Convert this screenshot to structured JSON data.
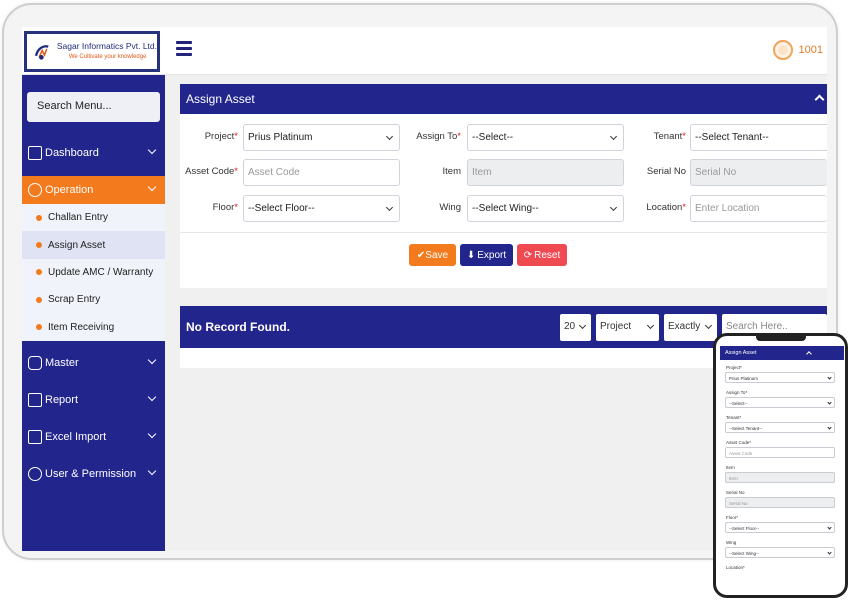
{
  "brand": {
    "name": "Sagar Informatics Pvt. Ltd.",
    "tagline": "We Cultivate your knowledge"
  },
  "header": {
    "user_id": "1001"
  },
  "sidebar": {
    "search_label": "Search Menu...",
    "items": [
      {
        "label": "Dashboard",
        "icon": "dashboard-icon"
      },
      {
        "label": "Operation",
        "icon": "gear-icon",
        "active": true
      },
      {
        "label": "Master",
        "icon": "database-icon"
      },
      {
        "label": "Report",
        "icon": "report-icon"
      },
      {
        "label": "Excel Import",
        "icon": "import-icon"
      },
      {
        "label": "User & Permission",
        "icon": "users-icon"
      }
    ],
    "submenu": [
      "Challan Entry",
      "Assign Asset",
      "Update AMC / Warranty",
      "Scrap Entry",
      "Item Receiving"
    ]
  },
  "form": {
    "title": "Assign Asset",
    "project": {
      "label": "Project",
      "value": "Prius Platinum"
    },
    "assign_to": {
      "label": "Assign To",
      "value": "--Select--"
    },
    "tenant": {
      "label": "Tenant",
      "value": "--Select Tenant--"
    },
    "asset_code": {
      "label": "Asset Code",
      "placeholder": "Asset Code"
    },
    "item": {
      "label": "Item",
      "placeholder": "Item"
    },
    "serial_no": {
      "label": "Serial No",
      "placeholder": "Serial No"
    },
    "floor": {
      "label": "Floor",
      "value": "--Select Floor--"
    },
    "wing": {
      "label": "Wing",
      "value": "--Select Wing--"
    },
    "location": {
      "label": "Location",
      "placeholder": "Enter Location"
    },
    "buttons": {
      "save": "Save",
      "export": "Export",
      "reset": "Reset"
    }
  },
  "results": {
    "status": "No Record Found.",
    "page_size": "20",
    "filter_field": "Project",
    "match_mode": "Exactly",
    "search_placeholder": "Search Here.."
  },
  "colors": {
    "primary": "#22258c",
    "accent": "#f37a1d",
    "danger": "#ef4a52"
  }
}
